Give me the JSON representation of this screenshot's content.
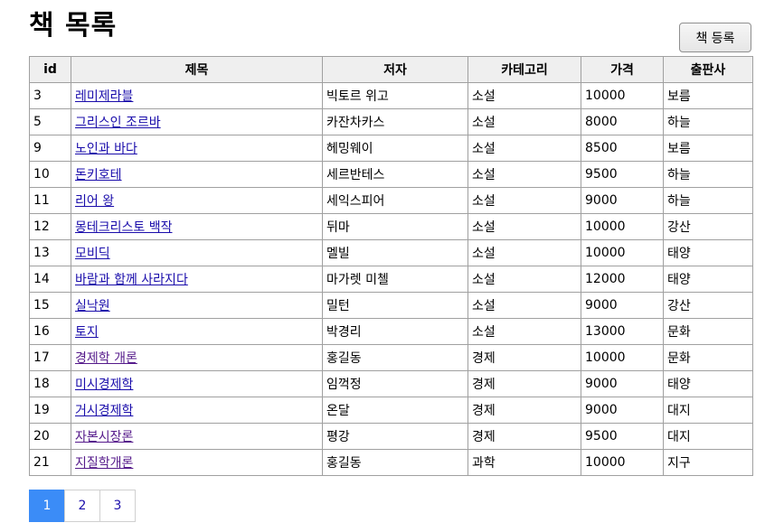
{
  "page": {
    "title": "책 목록",
    "register_button": "책 등록"
  },
  "table": {
    "headers": {
      "id": "id",
      "title": "제목",
      "author": "저자",
      "category": "카테고리",
      "price": "가격",
      "publisher": "출판사"
    },
    "rows": [
      {
        "id": "3",
        "title": "레미제라블",
        "author": "빅토르 위고",
        "category": "소설",
        "price": "10000",
        "publisher": "보름"
      },
      {
        "id": "5",
        "title": "그리스인 조르바",
        "author": "카잔차카스",
        "category": "소설",
        "price": "8000",
        "publisher": "하늘"
      },
      {
        "id": "9",
        "title": "노인과 바다",
        "author": "헤밍웨이",
        "category": "소설",
        "price": "8500",
        "publisher": "보름"
      },
      {
        "id": "10",
        "title": "돈키호테",
        "author": "세르반테스",
        "category": "소설",
        "price": "9500",
        "publisher": "하늘"
      },
      {
        "id": "11",
        "title": "리어 왕",
        "author": "세익스피어",
        "category": "소설",
        "price": "9000",
        "publisher": "하늘"
      },
      {
        "id": "12",
        "title": "몽테크리스토 백작",
        "author": "뒤마",
        "category": "소설",
        "price": "10000",
        "publisher": "강산"
      },
      {
        "id": "13",
        "title": "모비딕",
        "author": "멜빌",
        "category": "소설",
        "price": "10000",
        "publisher": "태양"
      },
      {
        "id": "14",
        "title": "바람과 함께 사라지다",
        "author": "마가렛 미첼",
        "category": "소설",
        "price": "12000",
        "publisher": "태양"
      },
      {
        "id": "15",
        "title": "실낙원",
        "author": "밀턴",
        "category": "소설",
        "price": "9000",
        "publisher": "강산"
      },
      {
        "id": "16",
        "title": "토지",
        "author": "박경리",
        "category": "소설",
        "price": "13000",
        "publisher": "문화"
      },
      {
        "id": "17",
        "title": "경제학 개론",
        "author": "홍길동",
        "category": "경제",
        "price": "10000",
        "publisher": "문화"
      },
      {
        "id": "18",
        "title": "미시경제학",
        "author": "임꺽정",
        "category": "경제",
        "price": "9000",
        "publisher": "태양"
      },
      {
        "id": "19",
        "title": "거시경제학",
        "author": "온달",
        "category": "경제",
        "price": "9000",
        "publisher": "대지"
      },
      {
        "id": "20",
        "title": "자본시장론",
        "author": "평강",
        "category": "경제",
        "price": "9500",
        "publisher": "대지"
      },
      {
        "id": "21",
        "title": "지질학개론",
        "author": "홍길동",
        "category": "과학",
        "price": "10000",
        "publisher": "지구"
      }
    ]
  },
  "pagination": {
    "pages": [
      "1",
      "2",
      "3"
    ],
    "current": "1",
    "active_color": "#3b8cf7"
  },
  "colors": {
    "link": "#1a0dab",
    "visited_link": "#551a8b"
  }
}
